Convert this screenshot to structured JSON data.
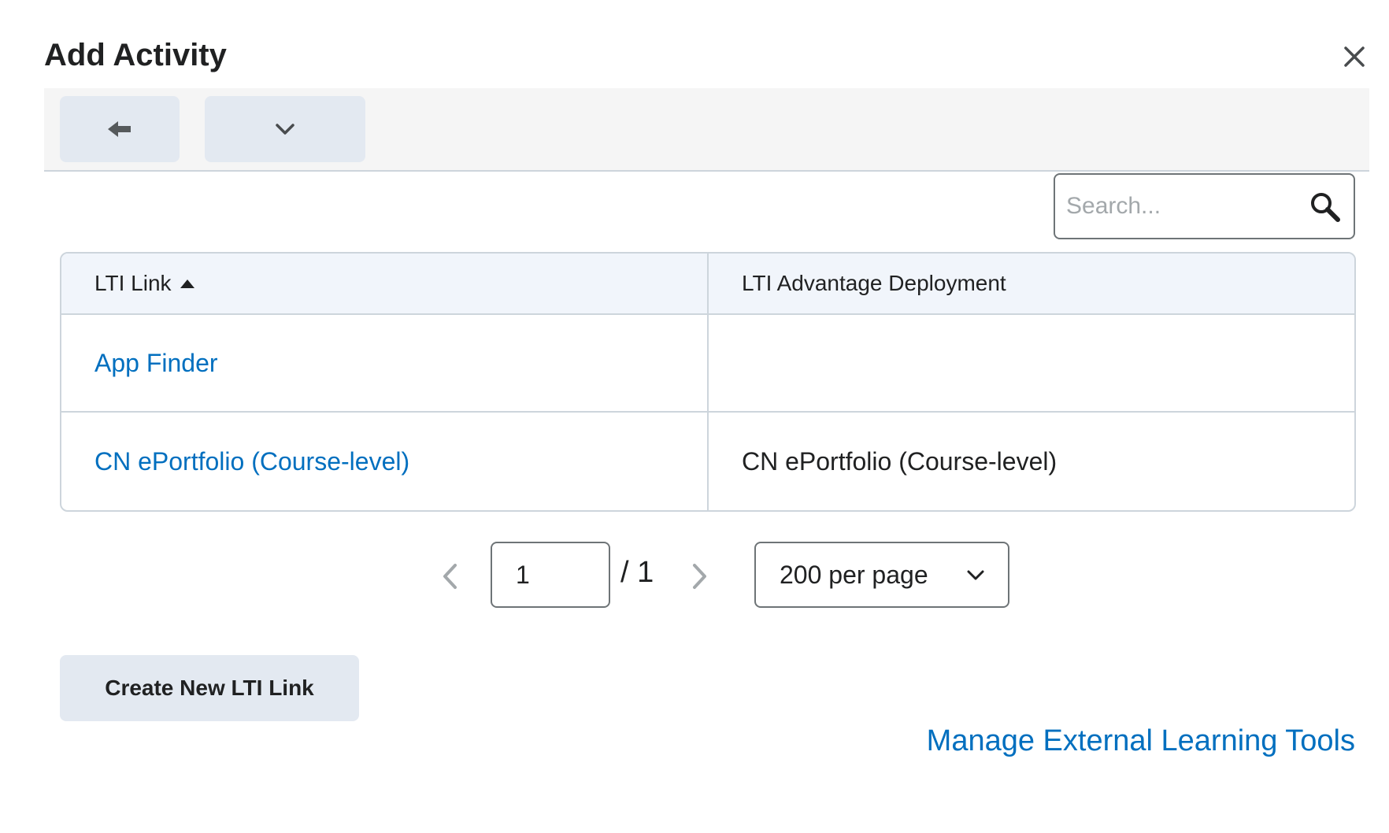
{
  "dialog": {
    "title": "Add Activity"
  },
  "toolbar": {
    "back_icon": "arrow-left-icon",
    "menu_icon": "chevron-down-icon"
  },
  "search": {
    "placeholder": "Search...",
    "value": "",
    "icon": "search-icon"
  },
  "table": {
    "columns": [
      {
        "label": "LTI Link",
        "sort": "ascending"
      },
      {
        "label": "LTI Advantage Deployment"
      }
    ],
    "rows": [
      {
        "link": "App Finder",
        "deployment": ""
      },
      {
        "link": "CN ePortfolio (Course-level)",
        "deployment": "CN ePortfolio (Course-level)"
      }
    ]
  },
  "pagination": {
    "current_page": "1",
    "total_label": "/ 1",
    "per_page_label": "200 per page"
  },
  "actions": {
    "create_label": "Create New LTI Link",
    "manage_label": "Manage External Learning Tools"
  },
  "colors": {
    "link": "#006fbf",
    "button_bg": "#e3e9f1",
    "header_bg": "#f1f5fb",
    "border": "#cdd5dc"
  }
}
